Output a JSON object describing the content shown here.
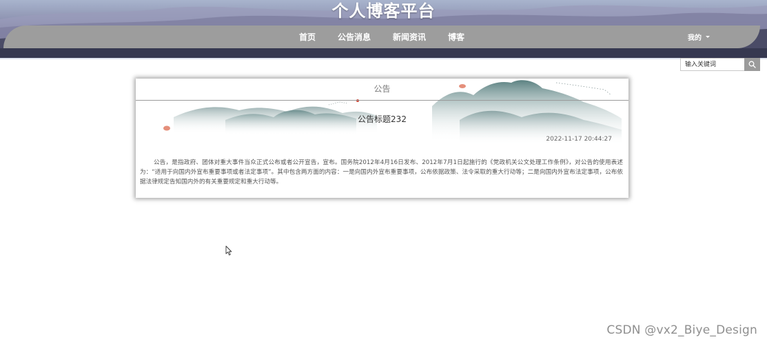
{
  "header": {
    "site_title": "个人博客平台",
    "nav_items": [
      "首页",
      "公告消息",
      "新闻资讯",
      "博客"
    ],
    "user_menu_label": "我的"
  },
  "search": {
    "placeholder": "输入关键词"
  },
  "notice": {
    "section_label": "公告",
    "title": "公告标题232",
    "datetime": "2022-11-17 20:44:27",
    "content": "公告，是指政府、团体对重大事件当众正式公布或者公开宣告，宣布。国务院2012年4月16日发布、2012年7月1日起施行的《党政机关公文处理工作条例》，对公告的使用表述为：“适用于向国内外宣布重要事项或者法定事项”。其中包含两方面的内容：一是向国内外宣布重要事项，公布依据政策、法令采取的重大行动等；二是向国内外宣布法定事项，公布依据法律规定告知国内外的有关重要规定和重大行动等。"
  },
  "watermark": "CSDN @vx2_Biye_Design",
  "colors": {
    "nav_bar": "#9d9d9d",
    "banner_dark": "#3a3d55",
    "search_button": "#9b9b9b"
  },
  "icons": {
    "search": "search-icon",
    "dropdown": "caret-down-icon",
    "cursor": "mouse-pointer-icon"
  }
}
